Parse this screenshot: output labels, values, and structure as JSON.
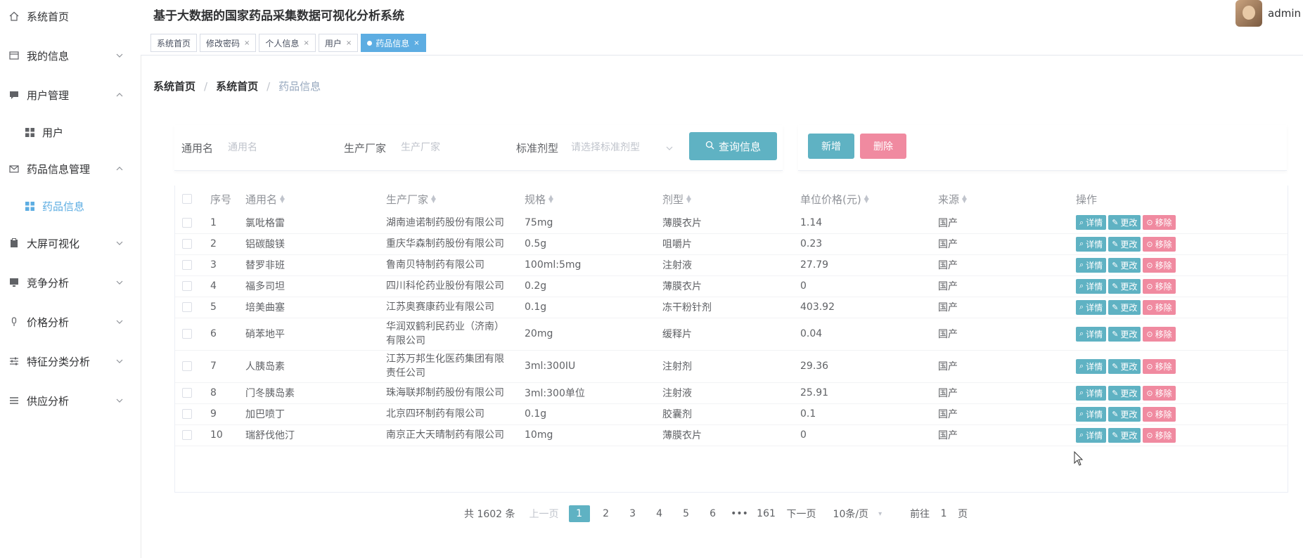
{
  "app": {
    "title": "基于大数据的国家药品采集数据可视化分析系统",
    "user": "admin"
  },
  "sidebar": {
    "items": [
      {
        "label": "系统首页",
        "icon": "home-icon"
      },
      {
        "label": "我的信息",
        "icon": "profile-card-icon"
      },
      {
        "label": "用户管理",
        "icon": "chat-icon"
      },
      {
        "label": "用户",
        "icon": "grid-icon"
      },
      {
        "label": "药品信息管理",
        "icon": "mail-icon"
      },
      {
        "label": "药品信息",
        "icon": "grid-icon"
      },
      {
        "label": "大屏可视化",
        "icon": "clipboard-icon"
      },
      {
        "label": "竞争分析",
        "icon": "monitor-icon"
      },
      {
        "label": "价格分析",
        "icon": "microphone-icon"
      },
      {
        "label": "特征分类分析",
        "icon": "sliders-icon"
      },
      {
        "label": "供应分析",
        "icon": "list-icon"
      }
    ]
  },
  "tabs": [
    {
      "label": "系统首页"
    },
    {
      "label": "修改密码"
    },
    {
      "label": "个人信息"
    },
    {
      "label": "用户"
    },
    {
      "label": "药品信息"
    }
  ],
  "breadcrumb": [
    "系统首页",
    "系统首页",
    "药品信息"
  ],
  "search": {
    "generic_label": "通用名",
    "generic_placeholder": "通用名",
    "maker_label": "生产厂家",
    "maker_placeholder": "生产厂家",
    "form_label": "标准剂型",
    "form_placeholder": "请选择标准剂型",
    "query_button": "查询信息",
    "add_button": "新增",
    "delete_button": "删除"
  },
  "table": {
    "columns": [
      "序号",
      "通用名",
      "生产厂家",
      "规格",
      "剂型",
      "单位价格(元)",
      "来源",
      "操作"
    ],
    "op_labels": {
      "detail": "详情",
      "edit": "更改",
      "remove": "移除"
    },
    "rows": [
      [
        "1",
        "氯吡格雷",
        "湖南迪诺制药股份有限公司",
        "75mg",
        "薄膜衣片",
        "1.14",
        "国产"
      ],
      [
        "2",
        "铝碳酸镁",
        "重庆华森制药股份有限公司",
        "0.5g",
        "咀嚼片",
        "0.23",
        "国产"
      ],
      [
        "3",
        "替罗非班",
        "鲁南贝特制药有限公司",
        "100ml:5mg",
        "注射液",
        "27.79",
        "国产"
      ],
      [
        "4",
        "福多司坦",
        "四川科伦药业股份有限公司",
        "0.2g",
        "薄膜衣片",
        "0",
        "国产"
      ],
      [
        "5",
        "培美曲塞",
        "江苏奥赛康药业有限公司",
        "0.1g",
        "冻干粉针剂",
        "403.92",
        "国产"
      ],
      [
        "6",
        "硝苯地平",
        "华润双鹤利民药业（济南）有限公司",
        "20mg",
        "缓释片",
        "0.04",
        "国产"
      ],
      [
        "7",
        "人胰岛素",
        "江苏万邦生化医药集团有限责任公司",
        "3ml:300IU",
        "注射剂",
        "29.36",
        "国产"
      ],
      [
        "8",
        "门冬胰岛素",
        "珠海联邦制药股份有限公司",
        "3ml:300单位",
        "注射液",
        "25.91",
        "国产"
      ],
      [
        "9",
        "加巴喷丁",
        "北京四环制药有限公司",
        "0.1g",
        "胶囊剂",
        "0.1",
        "国产"
      ],
      [
        "10",
        "瑞舒伐他汀",
        "南京正大天晴制药有限公司",
        "10mg",
        "薄膜衣片",
        "0",
        "国产"
      ]
    ]
  },
  "pagination": {
    "total": "共 1602 条",
    "prev": "上一页",
    "pages": [
      "1",
      "2",
      "3",
      "4",
      "5",
      "6"
    ],
    "ellipsis": "•••",
    "last": "161",
    "next": "下一页",
    "page_size": "10条/页",
    "goto_label": "前往",
    "goto_value": "1",
    "goto_suffix": "页"
  }
}
